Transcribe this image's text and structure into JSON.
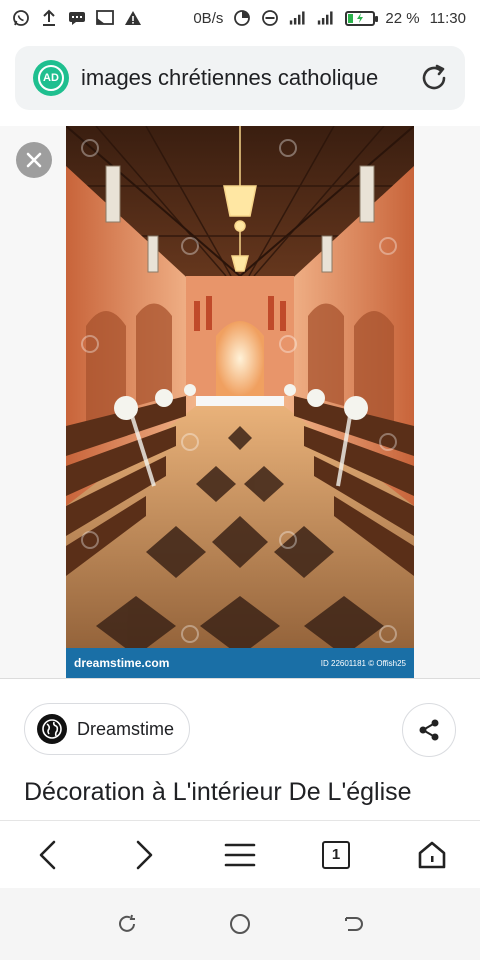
{
  "status_bar": {
    "net_speed": "0B/s",
    "battery_percent": "22 %",
    "battery_level": 0.22,
    "time": "11:30",
    "icons_left": [
      "whatsapp-icon",
      "upload-icon",
      "message-icon",
      "screen-cast-icon",
      "warning-icon"
    ],
    "icons_right": [
      "data-saver-icon",
      "do-not-disturb-icon",
      "signal-icon",
      "signal-2-icon",
      "battery-icon"
    ]
  },
  "address_bar": {
    "badge": "AD",
    "badge_color": "#1fbf8f",
    "query": "images chrétiennes catholique"
  },
  "image": {
    "watermark_brand": "dreamstime.com",
    "watermark_id": "ID 22601181 © Offish25"
  },
  "source": {
    "label": "Dreamstime"
  },
  "result_title": "Décoration à L'intérieur De L'église",
  "toolbar": {
    "tab_count": "1"
  },
  "colors": {
    "accent": "#1a6fa6",
    "battery_green": "#2bb24c"
  }
}
